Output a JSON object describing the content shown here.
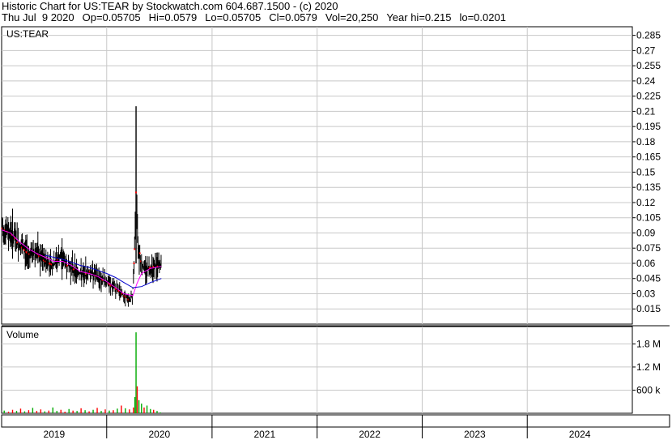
{
  "header": {
    "title": "Historic Chart for US:TEAR by Stockwatch.com 604.687.1500 - (c) 2020",
    "date": "Thu Jul  9 2020",
    "open": "Op=0.05705",
    "high": "Hi=0.0579",
    "low": "Lo=0.05705",
    "close": "Cl=0.0579",
    "volume": "Vol=20,250",
    "year_high": "Year hi=0.215",
    "year_low": "lo=0.0201"
  },
  "colors": {
    "up": "#00aa00",
    "down": "#ff0000",
    "price": "#000000",
    "ma_short": "#ff00ff",
    "ma_long": "#0000cc",
    "grid": "#c8c8c8"
  },
  "chart_data": [
    {
      "type": "line",
      "name": "price",
      "label": "US:TEAR",
      "y_ticks": [
        "0.285",
        "0.27",
        "0.255",
        "0.24",
        "0.225",
        "0.21",
        "0.195",
        "0.18",
        "0.165",
        "0.15",
        "0.135",
        "0.12",
        "0.105",
        "0.09",
        "0.075",
        "0.06",
        "0.045",
        "0.03",
        "0.015"
      ],
      "ylim": [
        0.0,
        0.2935
      ],
      "x_ticks": [
        "2019",
        "2020",
        "2021",
        "2022",
        "2023",
        "2024"
      ],
      "xlim": [
        "2019-01-01",
        "2024-12-31"
      ],
      "grid": true,
      "series": [
        {
          "x": [
            "2019-01-01",
            "2019-01-15",
            "2019-02-01",
            "2019-02-15",
            "2019-03-01",
            "2019-03-15",
            "2019-04-01",
            "2019-04-15",
            "2019-05-01",
            "2019-05-15",
            "2019-06-01",
            "2019-06-15",
            "2019-07-01",
            "2019-07-15",
            "2019-08-01",
            "2019-08-15",
            "2019-09-01",
            "2019-09-15",
            "2019-10-01",
            "2019-10-15",
            "2019-11-01",
            "2019-11-15",
            "2019-12-01",
            "2019-12-15",
            "2020-01-01",
            "2020-01-15",
            "2020-02-01",
            "2020-02-15",
            "2020-03-01",
            "2020-03-10",
            "2020-03-17",
            "2020-03-24",
            "2020-03-31",
            "2020-04-05",
            "2020-04-10",
            "2020-04-15",
            "2020-04-20",
            "2020-04-25",
            "2020-05-01",
            "2020-05-15",
            "2020-06-01",
            "2020-06-15",
            "2020-07-01",
            "2020-07-09"
          ],
          "values": [
            0.095,
            0.092,
            0.09,
            0.085,
            0.078,
            0.075,
            0.07,
            0.068,
            0.072,
            0.065,
            0.062,
            0.06,
            0.058,
            0.064,
            0.066,
            0.058,
            0.056,
            0.052,
            0.05,
            0.048,
            0.052,
            0.05,
            0.046,
            0.044,
            0.042,
            0.038,
            0.035,
            0.032,
            0.028,
            0.026,
            0.024,
            0.025,
            0.028,
            0.06,
            0.095,
            0.12,
            0.075,
            0.07,
            0.058,
            0.054,
            0.056,
            0.057,
            0.057,
            0.0579
          ]
        },
        {
          "x": [
            "2019-01-01",
            "2019-02-01",
            "2019-03-01",
            "2019-04-01",
            "2019-05-01",
            "2019-06-01",
            "2019-07-01",
            "2019-08-01",
            "2019-09-01",
            "2019-10-01",
            "2019-11-01",
            "2019-12-01",
            "2020-01-01",
            "2020-02-01",
            "2020-03-01",
            "2020-04-01",
            "2020-04-15",
            "2020-05-01",
            "2020-06-01",
            "2020-07-09"
          ],
          "values": [
            0.093,
            0.09,
            0.082,
            0.075,
            0.07,
            0.066,
            0.062,
            0.062,
            0.058,
            0.052,
            0.05,
            0.047,
            0.042,
            0.036,
            0.03,
            0.028,
            0.04,
            0.05,
            0.055,
            0.057
          ]
        },
        {
          "x": [
            "2019-06-01",
            "2019-07-01",
            "2019-08-01",
            "2019-09-01",
            "2019-10-01",
            "2019-11-01",
            "2019-12-01",
            "2020-01-01",
            "2020-02-01",
            "2020-03-01",
            "2020-04-01",
            "2020-05-01",
            "2020-06-01",
            "2020-07-09"
          ],
          "values": [
            0.068,
            0.066,
            0.064,
            0.061,
            0.058,
            0.056,
            0.053,
            0.05,
            0.046,
            0.041,
            0.036,
            0.037,
            0.041,
            0.045
          ]
        }
      ],
      "spike": {
        "x": "2020-04-12",
        "high": 0.215,
        "low": 0.06,
        "red_tick": 0.13
      }
    },
    {
      "type": "bar",
      "name": "volume",
      "label": "Volume",
      "y_ticks": [
        "1.8 M",
        "1.2 M",
        "600 k"
      ],
      "y_tick_values": [
        1800000,
        1200000,
        600000
      ],
      "ylim": [
        0,
        2250000
      ],
      "grid": true,
      "x": [
        "2019-01-10",
        "2019-01-25",
        "2019-02-08",
        "2019-02-22",
        "2019-03-08",
        "2019-03-22",
        "2019-04-05",
        "2019-04-19",
        "2019-05-03",
        "2019-05-17",
        "2019-05-31",
        "2019-06-14",
        "2019-06-28",
        "2019-07-12",
        "2019-07-26",
        "2019-08-09",
        "2019-08-23",
        "2019-09-06",
        "2019-09-20",
        "2019-10-04",
        "2019-10-18",
        "2019-11-01",
        "2019-11-15",
        "2019-11-29",
        "2019-12-13",
        "2019-12-27",
        "2020-01-10",
        "2020-01-24",
        "2020-02-07",
        "2020-02-21",
        "2020-03-06",
        "2020-03-20",
        "2020-04-03",
        "2020-04-08",
        "2020-04-12",
        "2020-04-16",
        "2020-04-22",
        "2020-05-01",
        "2020-05-10",
        "2020-05-20",
        "2020-06-01",
        "2020-06-12",
        "2020-06-24",
        "2020-07-06"
      ],
      "values": [
        70000,
        40000,
        90000,
        60000,
        120000,
        50000,
        80000,
        140000,
        60000,
        100000,
        50000,
        70000,
        150000,
        60000,
        90000,
        40000,
        110000,
        70000,
        60000,
        130000,
        80000,
        50000,
        90000,
        140000,
        60000,
        100000,
        70000,
        80000,
        120000,
        200000,
        130000,
        100000,
        150000,
        420000,
        2100000,
        700000,
        340000,
        250000,
        150000,
        200000,
        110000,
        90000,
        60000,
        20250
      ],
      "colors": [
        "up",
        "down",
        "down",
        "up",
        "down",
        "up",
        "down",
        "up",
        "down",
        "down",
        "up",
        "down",
        "up",
        "up",
        "down",
        "down",
        "up",
        "down",
        "up",
        "down",
        "up",
        "down",
        "up",
        "down",
        "up",
        "down",
        "up",
        "down",
        "up",
        "down",
        "up",
        "down",
        "down",
        "up",
        "up",
        "down",
        "up",
        "up",
        "down",
        "up",
        "up",
        "down",
        "up",
        "up"
      ]
    }
  ]
}
